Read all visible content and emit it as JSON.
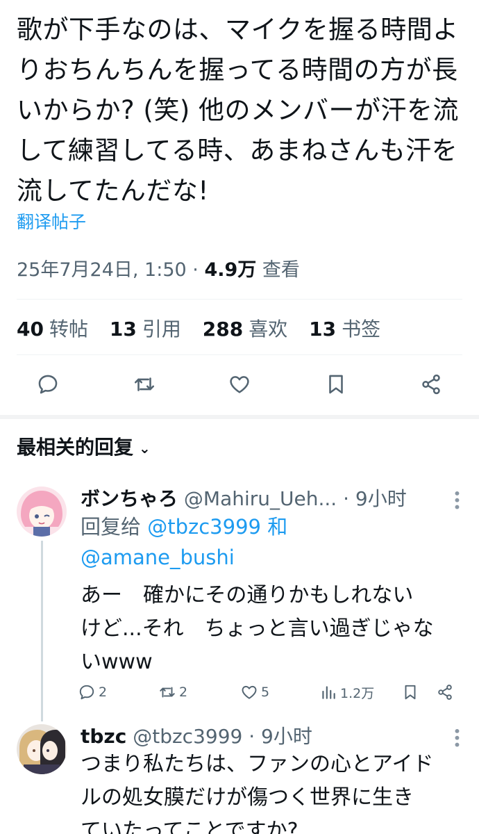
{
  "post": {
    "lines": [
      "歌が下手なのは、マイクを握る時間よ",
      "りおちんちんを握ってる時間の方が長",
      "いからか? (笑) 他のメンバーが汗を流",
      "して練習してる時、あまねさんも汗を",
      "流してたんだな!"
    ],
    "translate_label": "翻译帖子",
    "timestamp": "25年7月24日, 1:50",
    "views_value": "4.9万",
    "views_label": "查看"
  },
  "stats": [
    {
      "value": "40",
      "label": "转帖"
    },
    {
      "value": "13",
      "label": "引用"
    },
    {
      "value": "288",
      "label": "喜欢"
    },
    {
      "value": "13",
      "label": "书签"
    }
  ],
  "actions": [
    "reply-icon",
    "repost-icon",
    "like-icon",
    "bookmark-icon",
    "share-icon"
  ],
  "sort": {
    "label": "最相关的回复"
  },
  "replies": [
    {
      "name": "ボンちゃろ",
      "handle": "@Mahiru_Ueh...",
      "time": "· 9小时",
      "reply_to_label": "回复给",
      "reply_to_1": "@tbzc3999",
      "reply_to_and": "和",
      "reply_to_2": "@amane_bushi",
      "lines": [
        "あー　確かにその通りかもしれない",
        "けど...それ　ちょっと言い過ぎじゃな",
        "いwww"
      ],
      "counts": {
        "replies": "2",
        "reposts": "2",
        "likes": "5",
        "views": "1.2万"
      }
    },
    {
      "name": "tbzc",
      "handle": "@tbzc3999",
      "time": "· 9小时",
      "lines": [
        "つまり私たちは、ファンの心とアイド",
        "ルの処女膜だけが傷つく世界に生き",
        "ていたってことですか?"
      ]
    }
  ],
  "colors": {
    "accent": "#1d9bf0",
    "text": "#0f1419",
    "muted": "#536471",
    "divider": "#eff3f4"
  }
}
